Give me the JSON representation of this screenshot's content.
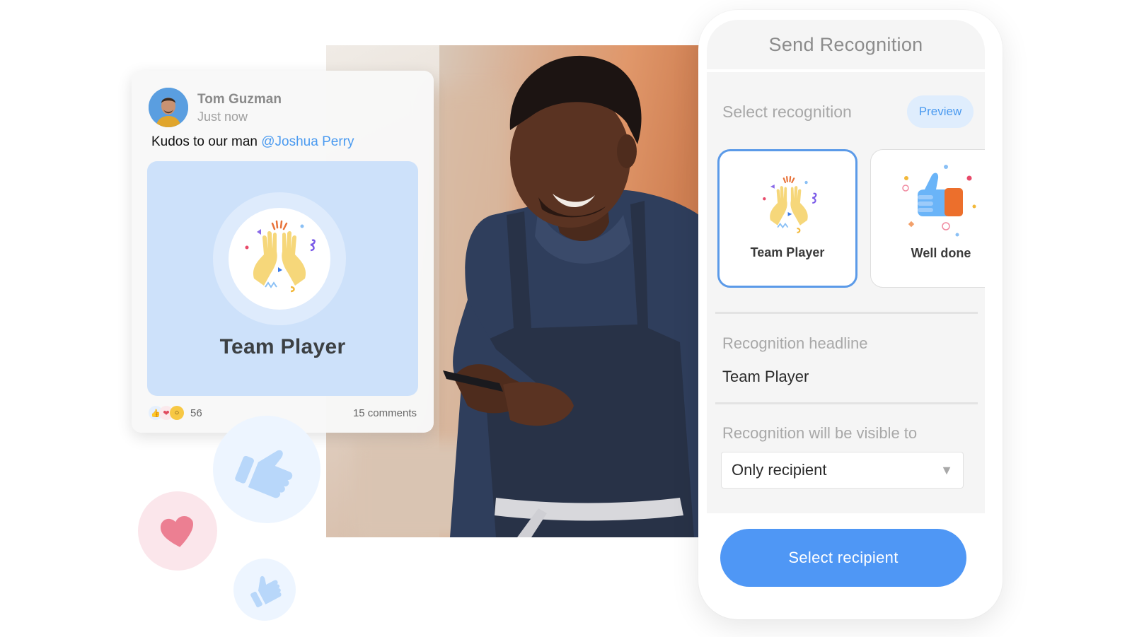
{
  "post": {
    "author": "Tom Guzman",
    "timestamp": "Just now",
    "message_prefix": "Kudos to our man ",
    "mention": "@Joshua Perry",
    "badge_title": "Team Player",
    "badge_icon": "high-five-icon",
    "reactions": [
      "thumbs-up-icon",
      "heart-icon",
      "wow-face-icon"
    ],
    "reaction_count": "56",
    "comments": "15 comments"
  },
  "floating_reactions": [
    "thumbs-up-icon",
    "heart-icon",
    "thumbs-up-icon"
  ],
  "panel": {
    "title": "Send Recognition",
    "select_label": "Select recognition",
    "preview_button": "Preview",
    "recognition_options": [
      {
        "label": "Team Player",
        "icon": "high-five-icon",
        "selected": true
      },
      {
        "label": "Well done",
        "icon": "thumbs-up-icon",
        "selected": false
      }
    ],
    "headline_label": "Recognition headline",
    "headline_value": "Team Player",
    "visibility_label": "Recognition will be visible to",
    "visibility_value": "Only recipient",
    "cta_button": "Select recipient"
  },
  "colors": {
    "accent": "#4f97f5",
    "mention": "#4a9af0",
    "badge_background": "#cde1fa",
    "selected_border": "#5b9ae8",
    "panel_background": "#f5f5f5"
  }
}
